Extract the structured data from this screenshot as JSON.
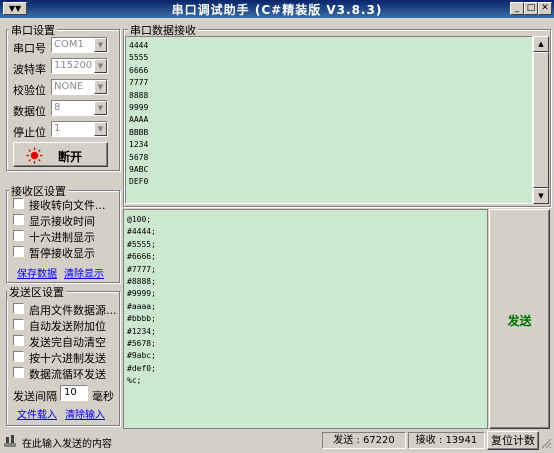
{
  "window": {
    "title": "串口调试助手 (C#精装版 V3.8.3)",
    "system_menu": "▼▼",
    "minimize": "_",
    "maximize": "□",
    "close": "✕"
  },
  "serial_settings": {
    "group_title": "串口设置",
    "port_label": "串口号",
    "port_value": "COM1",
    "baud_label": "波特率",
    "baud_value": "115200",
    "parity_label": "校验位",
    "parity_value": "NONE",
    "databits_label": "数据位",
    "databits_value": "8",
    "stopbits_label": "停止位",
    "stopbits_value": "1",
    "toggle_button": "断开",
    "status_color": "#e00000"
  },
  "receive_settings": {
    "group_title": "接收区设置",
    "options": [
      "接收转向文件...",
      "显示接收时间",
      "十六进制显示",
      "暂停接收显示"
    ],
    "save_link": "保存数据",
    "clear_link": "清除显示"
  },
  "send_settings": {
    "group_title": "发送区设置",
    "options": [
      "启用文件数据源...",
      "自动发送附加位",
      "发送完自动清空",
      "按十六进制发送",
      "数据流循环发送"
    ],
    "interval_label": "发送间隔",
    "interval_value": "10",
    "interval_unit": "毫秒",
    "file_link": "文件载入",
    "clear_link": "清除输入"
  },
  "receive_area": {
    "title": "串口数据接收",
    "lines": [
      "4444",
      "5555",
      "6666",
      "7777",
      "8888",
      "9999",
      "AAAA",
      "BBBB",
      "1234",
      "5678",
      "9ABC",
      "DEF0"
    ]
  },
  "send_area": {
    "lines": [
      "@100;",
      "#4444;",
      "#5555;",
      "#6666;",
      "#7777;",
      "#8888;",
      "#9999;",
      "#aaaa;",
      "#bbbb;",
      "#1234;",
      "#5678;",
      "#9abc;",
      "#def0;",
      "%c;"
    ],
    "send_button": "发送"
  },
  "status_bar": {
    "hint": "在此输入发送的内容",
    "sent_label": "发送 : 67220",
    "received_label": "接收 : 13941",
    "reset_button": "复位计数"
  },
  "colors": {
    "text_area_bg": "#cce8cf",
    "send_button_text": "#007000",
    "window_bg": "#d4d0c8"
  }
}
